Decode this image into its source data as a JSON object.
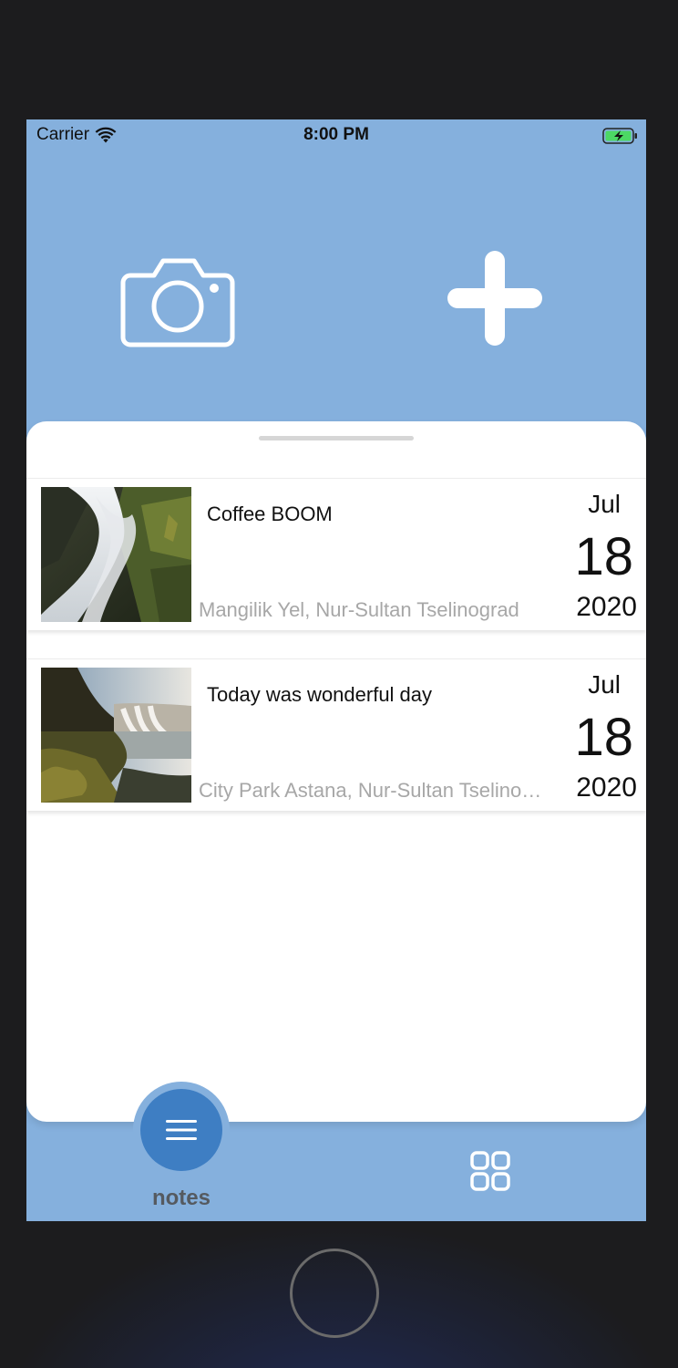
{
  "status_bar": {
    "carrier": "Carrier",
    "time": "8:00 PM",
    "icons": [
      "wifi-icon",
      "battery-charging-icon"
    ]
  },
  "header": {
    "actions": [
      {
        "icon": "camera-icon"
      },
      {
        "icon": "plus-icon"
      }
    ]
  },
  "notes": [
    {
      "title": "Coffee BOOM",
      "location": "Mangilik Yel, Nur-Sultan Tselinograd",
      "month": "Jul",
      "day": "18",
      "year": "2020",
      "thumbnail": "waterfall-photo"
    },
    {
      "title": "Today was wonderful day",
      "location": "City Park Astana, Nur-Sultan Tselinograd",
      "month": "Jul",
      "day": "18",
      "year": "2020",
      "thumbnail": "waterfall-landscape-photo"
    }
  ],
  "tab_bar": {
    "notes_label": "notes",
    "notes_icon": "menu-lines-icon",
    "grid_icon": "grid-icon"
  },
  "colors": {
    "accent_background": "#85b0dd",
    "active_tab": "#3e7ec3",
    "location_text": "#a7a7a7"
  }
}
